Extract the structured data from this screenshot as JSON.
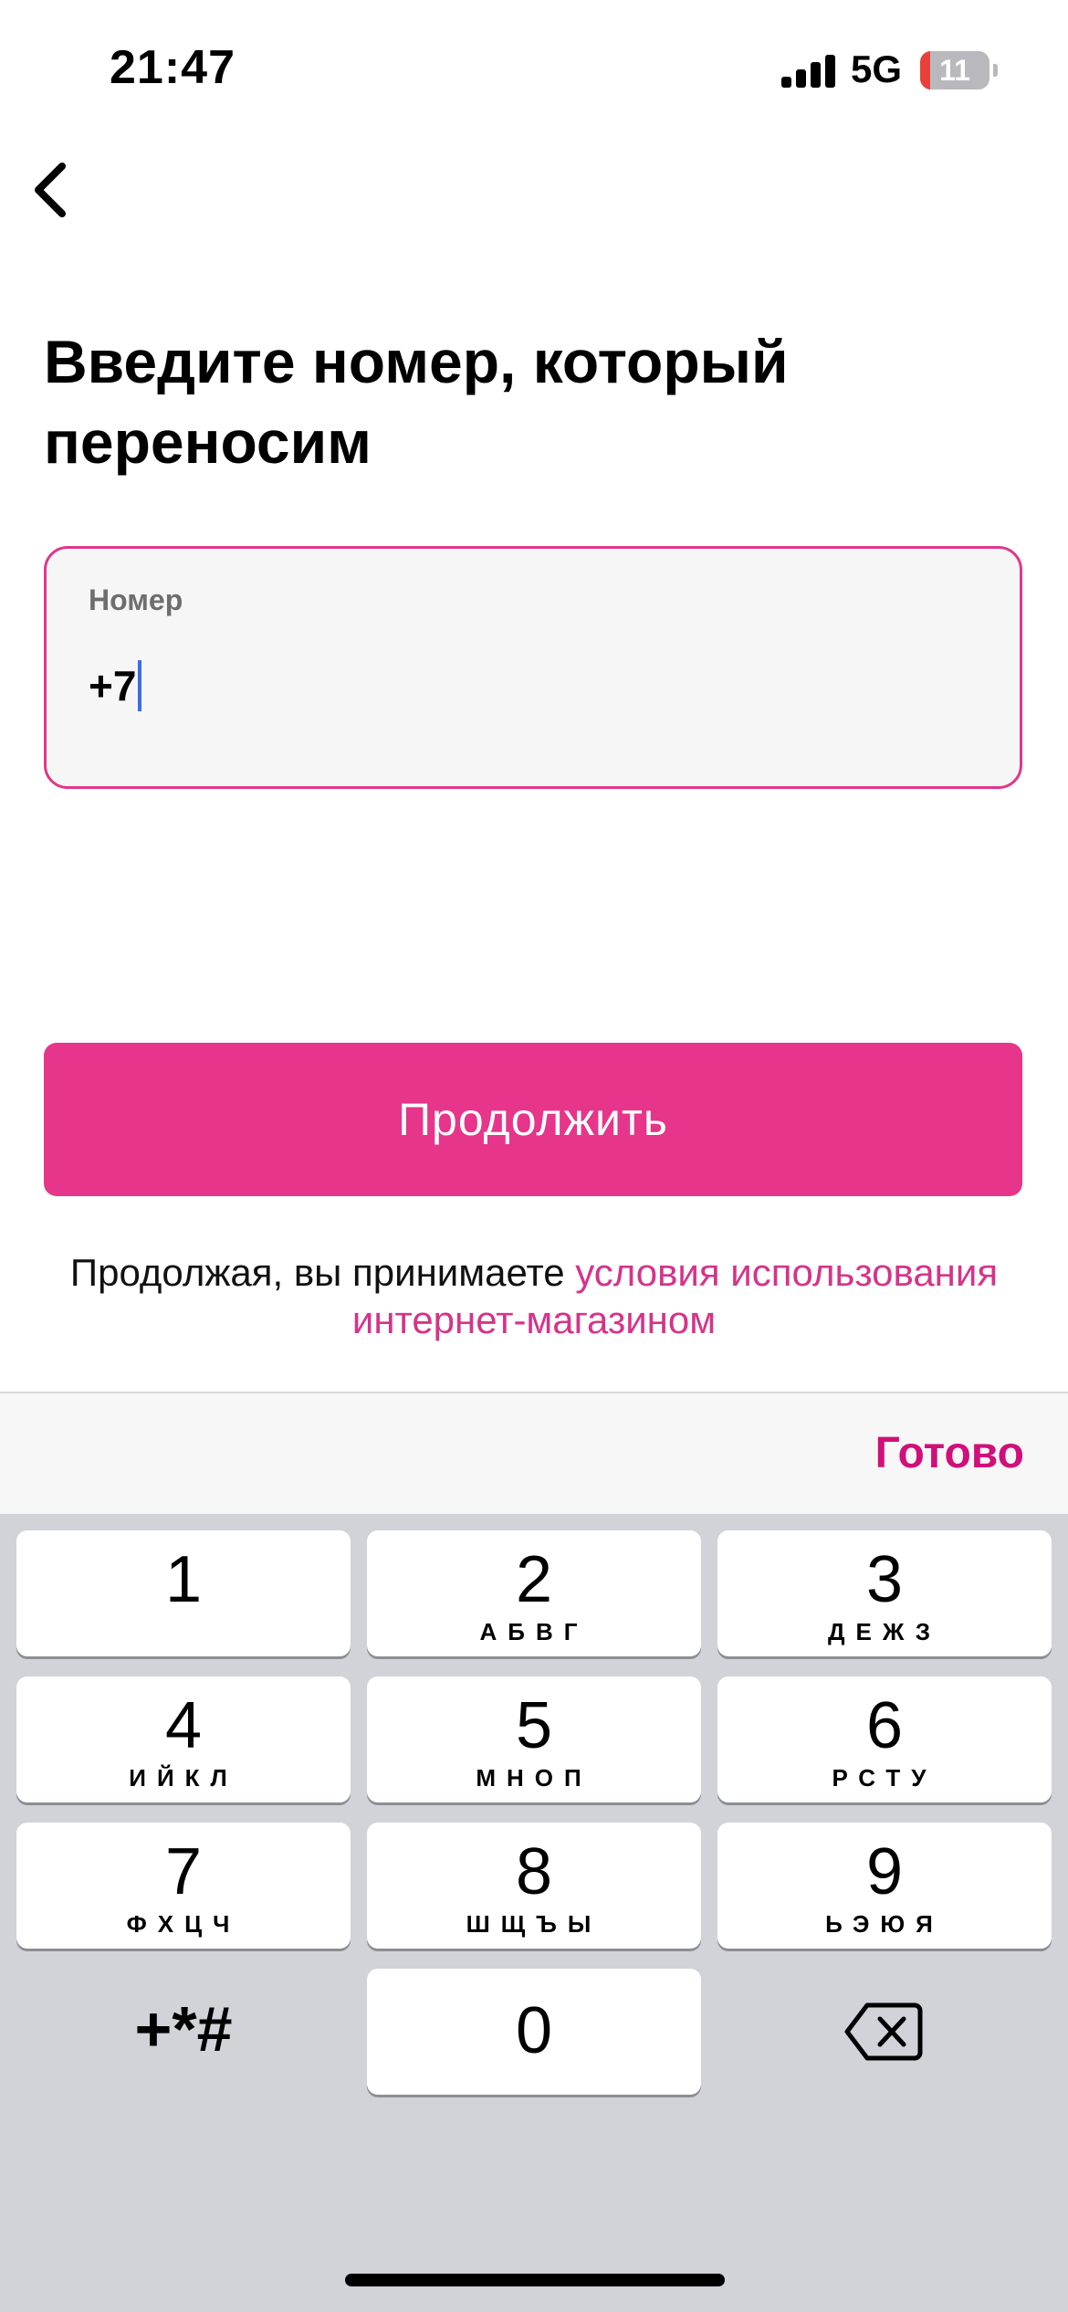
{
  "status_bar": {
    "time": "21:47",
    "network": "5G",
    "battery": "11",
    "battery_level": 0.11
  },
  "nav": {
    "back_icon": "chevron-left-icon"
  },
  "title": "Введите номер, который переносим",
  "phone_field": {
    "label": "Номер",
    "value": "+7"
  },
  "continue_button": "Продолжить",
  "terms": {
    "prefix": "Продолжая, вы принимаете ",
    "link": "условия использования интернет-магазином"
  },
  "keyboard_toolbar": {
    "done": "Готово"
  },
  "keypad": {
    "keys": [
      {
        "digit": "1",
        "letters": ""
      },
      {
        "digit": "2",
        "letters": "АБВГ"
      },
      {
        "digit": "3",
        "letters": "ДЕЖЗ"
      },
      {
        "digit": "4",
        "letters": "ИЙКЛ"
      },
      {
        "digit": "5",
        "letters": "МНОП"
      },
      {
        "digit": "6",
        "letters": "РСТУ"
      },
      {
        "digit": "7",
        "letters": "ФХЦЧ"
      },
      {
        "digit": "8",
        "letters": "ШЩЪЫ"
      },
      {
        "digit": "9",
        "letters": "ЬЭЮЯ"
      }
    ],
    "symbols": "+*#",
    "zero": "0",
    "delete_icon": "backspace-icon"
  },
  "colors": {
    "accent": "#E6358A",
    "link": "#D6338A",
    "done": "#D10F7A",
    "caret": "#3B6EE8"
  }
}
